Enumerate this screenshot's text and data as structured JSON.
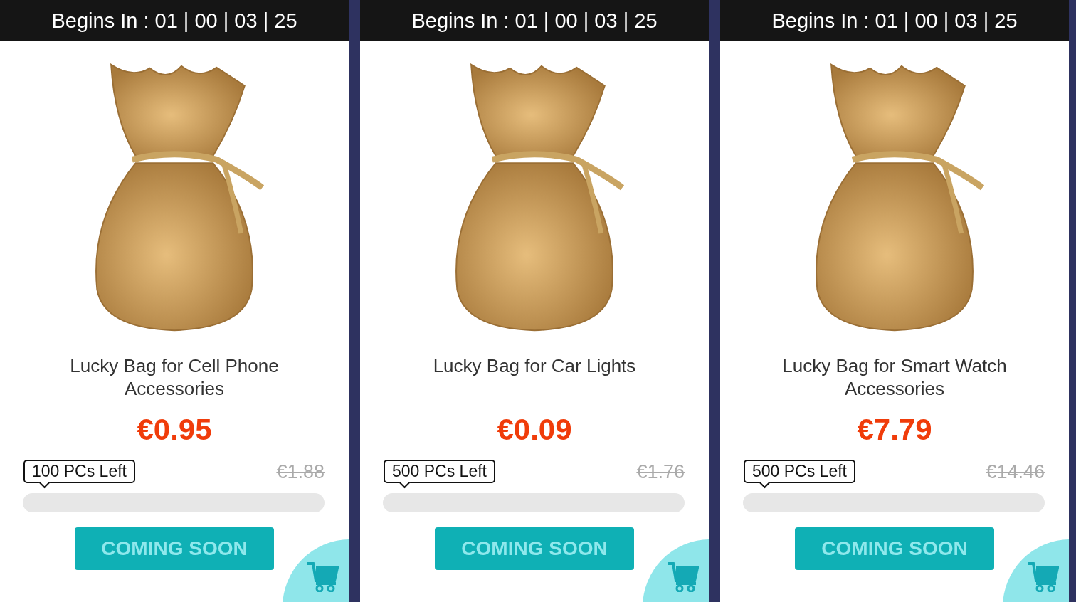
{
  "deals": [
    {
      "countdown": "Begins In : 01 | 00 | 03 | 25",
      "title": "Lucky Bag for Cell Phone Accessories",
      "price": "€0.95",
      "stock": "100 PCs Left",
      "old_price": "€1.88",
      "level": 0,
      "button": "COMING SOON"
    },
    {
      "countdown": "Begins In : 01 | 00 | 03 | 25",
      "title": "Lucky Bag for Car Lights",
      "price": "€0.09",
      "stock": "500 PCs Left",
      "old_price": "€1.76",
      "level": 0,
      "button": "COMING SOON"
    },
    {
      "countdown": "Begins In : 01 | 00 | 03 | 25",
      "title": "Lucky Bag for Smart Watch Accessories",
      "price": "€7.79",
      "stock": "500 PCs Left",
      "old_price": "€14.46",
      "level": 0,
      "button": "COMING SOON"
    }
  ]
}
